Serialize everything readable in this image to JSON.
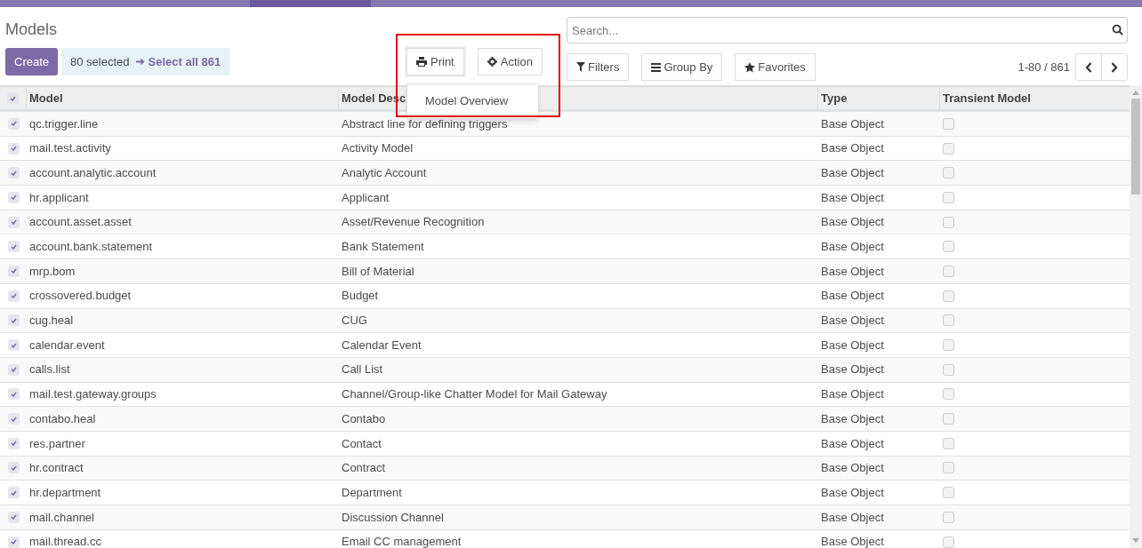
{
  "title": "Models",
  "create_button": "Create",
  "selection": {
    "count": "80 selected",
    "select_all": "Select all 861"
  },
  "print_button": "Print",
  "action_button": "Action",
  "print_menu": [
    "Model Overview"
  ],
  "search": {
    "placeholder": "Search..."
  },
  "filters_button": "Filters",
  "group_by_button": "Group By",
  "favorites_button": "Favorites",
  "pager": "1-80 / 861",
  "table": {
    "all_selected": true,
    "columns": [
      "Model",
      "Model Desc",
      "Type",
      "Transient Model"
    ],
    "rows": [
      {
        "model": "qc.trigger.line",
        "description": "Abstract line for defining triggers",
        "type": "Base Object",
        "transient": false,
        "selected": true
      },
      {
        "model": "mail.test.activity",
        "description": "Activity Model",
        "type": "Base Object",
        "transient": false,
        "selected": true
      },
      {
        "model": "account.analytic.account",
        "description": "Analytic Account",
        "type": "Base Object",
        "transient": false,
        "selected": true
      },
      {
        "model": "hr.applicant",
        "description": "Applicant",
        "type": "Base Object",
        "transient": false,
        "selected": true
      },
      {
        "model": "account.asset.asset",
        "description": "Asset/Revenue Recognition",
        "type": "Base Object",
        "transient": false,
        "selected": true
      },
      {
        "model": "account.bank.statement",
        "description": "Bank Statement",
        "type": "Base Object",
        "transient": false,
        "selected": true
      },
      {
        "model": "mrp.bom",
        "description": "Bill of Material",
        "type": "Base Object",
        "transient": false,
        "selected": true
      },
      {
        "model": "crossovered.budget",
        "description": "Budget",
        "type": "Base Object",
        "transient": false,
        "selected": true
      },
      {
        "model": "cug.heal",
        "description": "CUG",
        "type": "Base Object",
        "transient": false,
        "selected": true
      },
      {
        "model": "calendar.event",
        "description": "Calendar Event",
        "type": "Base Object",
        "transient": false,
        "selected": true
      },
      {
        "model": "calls.list",
        "description": "Call List",
        "type": "Base Object",
        "transient": false,
        "selected": true
      },
      {
        "model": "mail.test.gateway.groups",
        "description": "Channel/Group-like Chatter Model for Mail Gateway",
        "type": "Base Object",
        "transient": false,
        "selected": true
      },
      {
        "model": "contabo.heal",
        "description": "Contabo",
        "type": "Base Object",
        "transient": false,
        "selected": true
      },
      {
        "model": "res.partner",
        "description": "Contact",
        "type": "Base Object",
        "transient": false,
        "selected": true
      },
      {
        "model": "hr.contract",
        "description": "Contract",
        "type": "Base Object",
        "transient": false,
        "selected": true
      },
      {
        "model": "hr.department",
        "description": "Department",
        "type": "Base Object",
        "transient": false,
        "selected": true
      },
      {
        "model": "mail.channel",
        "description": "Discussion Channel",
        "type": "Base Object",
        "transient": false,
        "selected": true
      },
      {
        "model": "mail.thread.cc",
        "description": "Email CC management",
        "type": "Base Object",
        "transient": false,
        "selected": true
      }
    ]
  }
}
